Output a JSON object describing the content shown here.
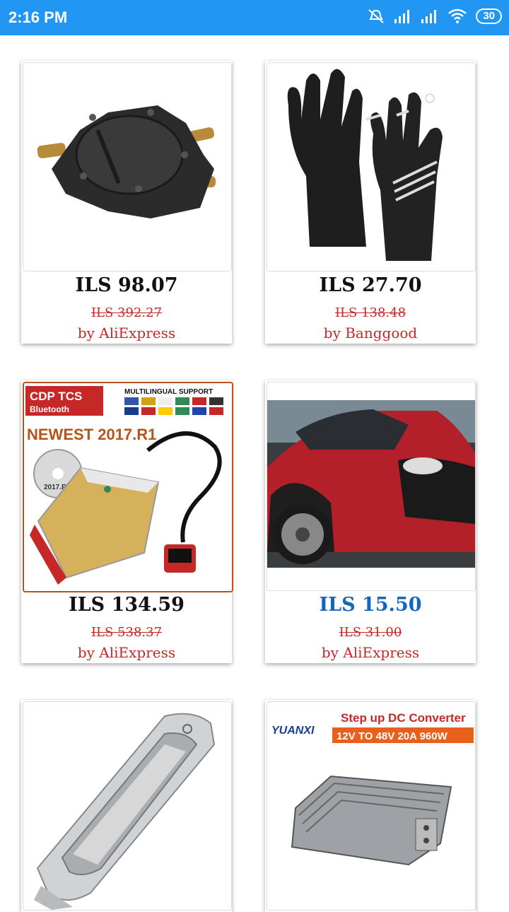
{
  "status_bar": {
    "time": "2:16 PM",
    "battery": "30",
    "icons": [
      "mute-icon",
      "signal-icon",
      "signal-icon",
      "wifi-icon",
      "battery-icon"
    ]
  },
  "products": [
    {
      "price": "ILS 98.07",
      "old_price": "ILS 392.27",
      "seller": "by AliExpress",
      "image": "fuel-pump"
    },
    {
      "price": "ILS 27.70",
      "old_price": "ILS 138.48",
      "seller": "by Banggood",
      "image": "gloves"
    },
    {
      "price": "ILS 134.59",
      "old_price": "ILS 538.37",
      "seller": "by AliExpress",
      "image": "cdp-tcs-scanner",
      "image_text": {
        "brand": "CDP TCS",
        "bt": "Bluetooth",
        "support": "MULTILINGUAL SUPPORT",
        "version": "NEWEST 2017.R1",
        "disc": "2017.R1"
      }
    },
    {
      "price": "ILS 15.50",
      "old_price": "ILS 31.00",
      "seller": "by AliExpress",
      "image": "red-car",
      "price_color": "#1565c0"
    },
    {
      "image": "dome-light"
    },
    {
      "image": "dc-converter",
      "image_text": {
        "brand": "YUANXI",
        "title": "Step up DC Converter",
        "spec": "12V TO 48V 20A 960W"
      }
    }
  ],
  "colors": {
    "status_bar": "#2196f3",
    "old_price": "#c62828",
    "seller": "#c62828",
    "highlight_price": "#1565c0"
  }
}
